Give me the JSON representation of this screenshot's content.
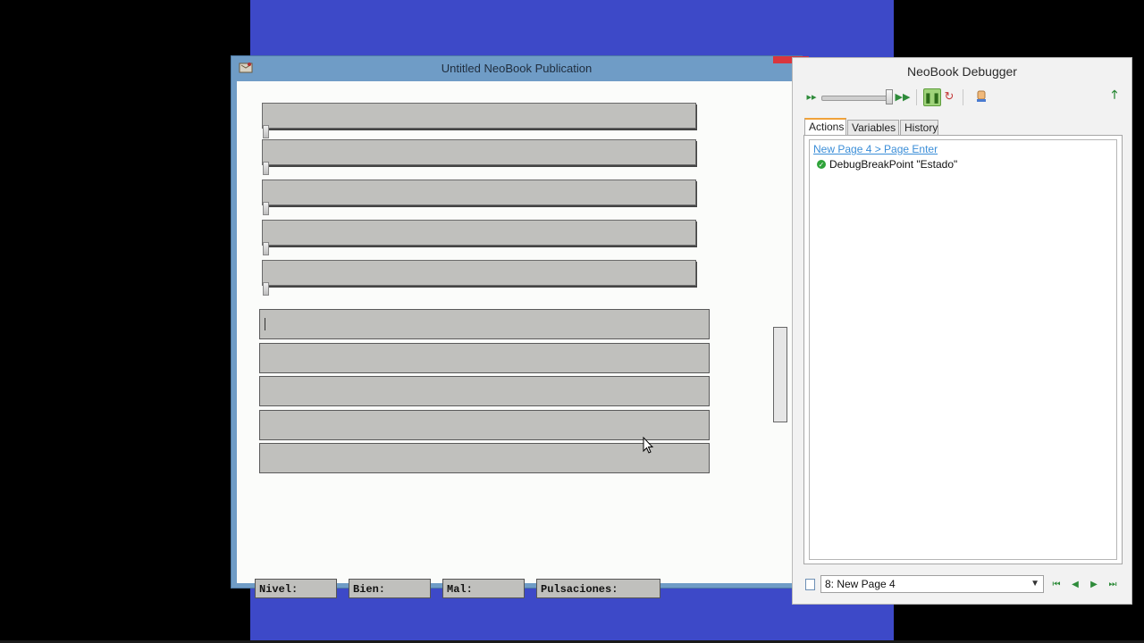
{
  "neobook": {
    "title": "Untitled NeoBook Publication",
    "status": {
      "nivel": "Nivel:",
      "bien": "Bien:",
      "mal": "Mal:",
      "pulsaciones": "Pulsaciones:"
    }
  },
  "debugger": {
    "title": "NeoBook Debugger",
    "tabs": [
      "Actions",
      "Variables",
      "History"
    ],
    "actions": {
      "event_link": "New Page 4 > Page Enter",
      "items": [
        "DebugBreakPoint \"Estado\""
      ]
    },
    "page_select": {
      "value": "8: New Page 4"
    }
  },
  "colors": {
    "desktop": "#3d49c8",
    "titlebar": "#6f9cc6",
    "control_gray": "#c0c0bd",
    "link_blue": "#3b8ed8",
    "ok_green": "#2fa33a",
    "tab_accent": "#f0a23a"
  }
}
